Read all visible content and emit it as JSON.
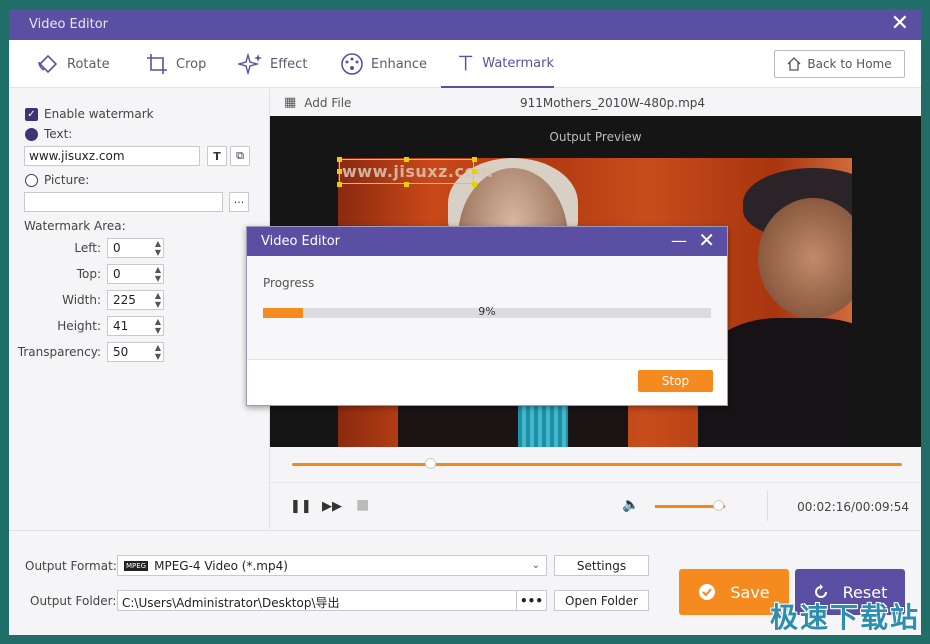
{
  "window": {
    "title": "Video Editor",
    "close": "✕"
  },
  "toolbar": {
    "tabs": [
      {
        "label": "Rotate",
        "icon": "rotate-icon"
      },
      {
        "label": "Crop",
        "icon": "crop-icon"
      },
      {
        "label": "Effect",
        "icon": "effect-icon"
      },
      {
        "label": "Enhance",
        "icon": "enhance-icon"
      },
      {
        "label": "Watermark",
        "icon": "watermark-icon",
        "active": true
      }
    ],
    "back_label": "Back to Home"
  },
  "left": {
    "enable_label": "Enable watermark",
    "text_label": "Text:",
    "text_value": "www.jisuxz.com",
    "picture_label": "Picture:",
    "picture_value": "",
    "browse": "···",
    "area_label": "Watermark Area:",
    "fields": [
      {
        "label": "Left:",
        "value": "0"
      },
      {
        "label": "Top:",
        "value": "0"
      },
      {
        "label": "Width:",
        "value": "225"
      },
      {
        "label": "Height:",
        "value": "41"
      },
      {
        "label": "Transparency:",
        "value": "50"
      }
    ]
  },
  "preview": {
    "add_file": "Add File",
    "filename": "911Mothers_2010W-480p.mp4",
    "output_label": "Output Preview",
    "watermark_text": "www.jisuxz.com",
    "timeline_position": 0.226,
    "volume_level": 0.9,
    "timecode": "00:02:16/00:09:54"
  },
  "bottom": {
    "format_label": "Output Format:",
    "format_badge": "MPEG",
    "format_value": "MPEG-4 Video (*.mp4)",
    "settings_label": "Settings",
    "folder_label": "Output Folder:",
    "folder_value": "C:\\Users\\Administrator\\Desktop\\导出",
    "folder_dots": "•••",
    "open_folder_label": "Open Folder",
    "save_label": "Save",
    "reset_label": "Reset"
  },
  "dialog": {
    "title": "Video Editor",
    "progress_label": "Progress",
    "progress_text": "9%",
    "progress_value": 0.09,
    "stop_label": "Stop"
  },
  "site_logo": "极速下载站",
  "colors": {
    "accent": "#5b4fa3",
    "orange": "#f58a1f"
  }
}
